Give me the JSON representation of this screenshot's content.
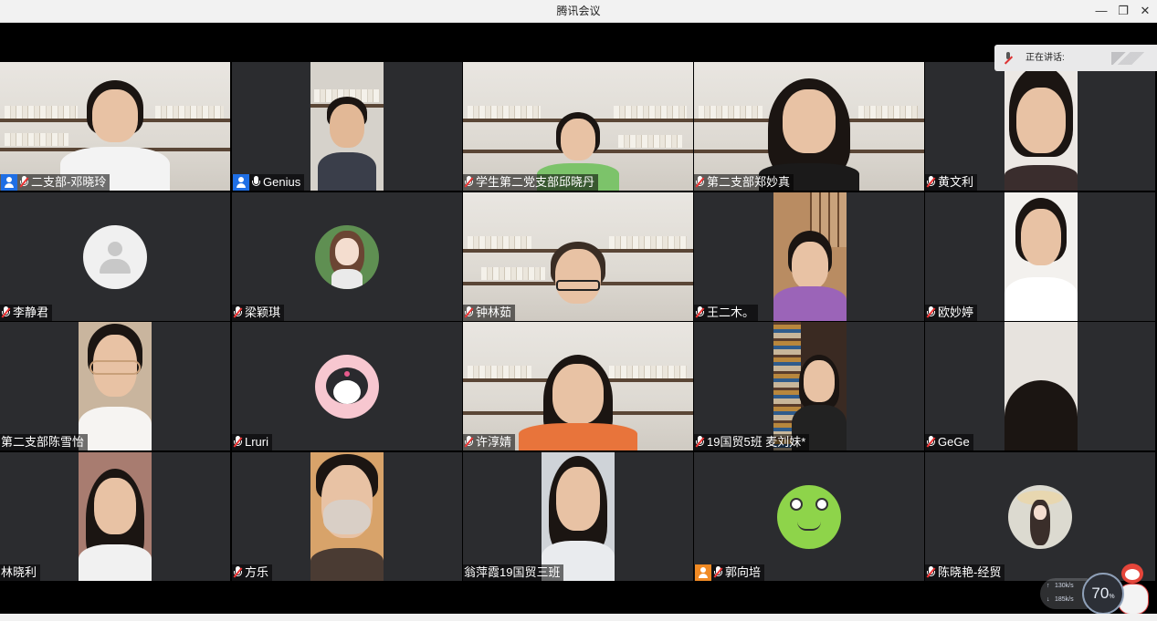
{
  "window": {
    "title": "腾讯会议",
    "minimize_icon": "minimize-icon",
    "restore_icon": "restore-icon",
    "close_icon": "close-icon"
  },
  "speaking": {
    "label": "正在讲话:"
  },
  "network": {
    "upload": "130k/s",
    "download": "185k/s"
  },
  "gauge": {
    "value": "70",
    "unit": "%"
  },
  "participants": [
    {
      "name": "二支部-邓晓玲",
      "host_icon": true,
      "mic": "muted"
    },
    {
      "name": "Genius",
      "host_icon": true,
      "mic": "on"
    },
    {
      "name": "学生第二党支部邱晓丹",
      "host_icon": false,
      "mic": "muted"
    },
    {
      "name": "第二支部郑妙真",
      "host_icon": false,
      "mic": "muted"
    },
    {
      "name": "黄文利",
      "host_icon": false,
      "mic": "muted"
    },
    {
      "name": "李静君",
      "host_icon": false,
      "mic": "muted"
    },
    {
      "name": "梁颖琪",
      "host_icon": false,
      "mic": "muted"
    },
    {
      "name": "钟林茹",
      "host_icon": false,
      "mic": "muted"
    },
    {
      "name": "王二木。",
      "host_icon": false,
      "mic": "muted"
    },
    {
      "name": "欧妙婷",
      "host_icon": false,
      "mic": "muted"
    },
    {
      "name": "第二支部陈雪怡",
      "host_icon": false,
      "mic": "none"
    },
    {
      "name": "Lruri",
      "host_icon": false,
      "mic": "muted"
    },
    {
      "name": "许淳婧",
      "host_icon": false,
      "mic": "muted"
    },
    {
      "name": "19国贸5班 麦刘妹*",
      "host_icon": false,
      "mic": "muted"
    },
    {
      "name": "GeGe",
      "host_icon": false,
      "mic": "muted"
    },
    {
      "name": "林晓利",
      "host_icon": false,
      "mic": "none"
    },
    {
      "name": "方乐",
      "host_icon": false,
      "mic": "muted"
    },
    {
      "name": "翁萍霞19国贸三班",
      "host_icon": false,
      "mic": "none"
    },
    {
      "name": "郭向培",
      "host_icon": true,
      "host_color": "#f08a24",
      "mic": "muted"
    },
    {
      "name": "陈晓艳-经贸",
      "host_icon": false,
      "mic": "muted"
    }
  ]
}
